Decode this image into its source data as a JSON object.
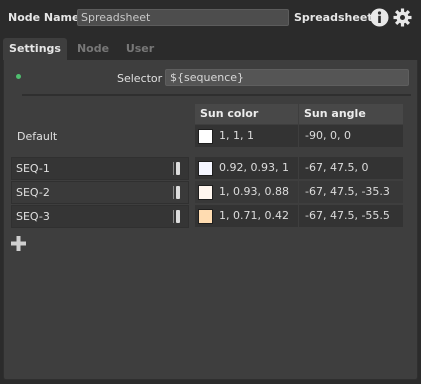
{
  "header": {
    "label": "Node Name",
    "name_value": "Spreadsheet",
    "node_type": "Spreadsheet"
  },
  "tabs": [
    {
      "label": "Settings",
      "active": true
    },
    {
      "label": "Node",
      "active": false
    },
    {
      "label": "User",
      "active": false
    }
  ],
  "selector": {
    "label": "Selector",
    "value": "${sequence}"
  },
  "columns": [
    "Sun color",
    "Sun angle"
  ],
  "default_row": {
    "label": "Default",
    "sun_color": "1, 1, 1",
    "sun_color_hex": "#ffffff",
    "sun_angle": "-90, 0, 0"
  },
  "rows": [
    {
      "name": "SEQ-1",
      "sun_color": "0.92, 0.93, 1",
      "sun_color_hex": "#f5f6ff",
      "sun_angle": "-67, 47.5, 0"
    },
    {
      "name": "SEQ-2",
      "sun_color": "1, 0.93, 0.88",
      "sun_color_hex": "#fff6ef",
      "sun_angle": "-67, 47.5, -35.3"
    },
    {
      "name": "SEQ-3",
      "sun_color": "1, 0.71, 0.42",
      "sun_color_hex": "#ffdcb1",
      "sun_angle": "-67, 47.5, -55.5"
    }
  ],
  "icons": {
    "info": "info-icon",
    "settings": "gear-icon",
    "add_row": "plus-icon",
    "active_indicator": "status-dot"
  }
}
